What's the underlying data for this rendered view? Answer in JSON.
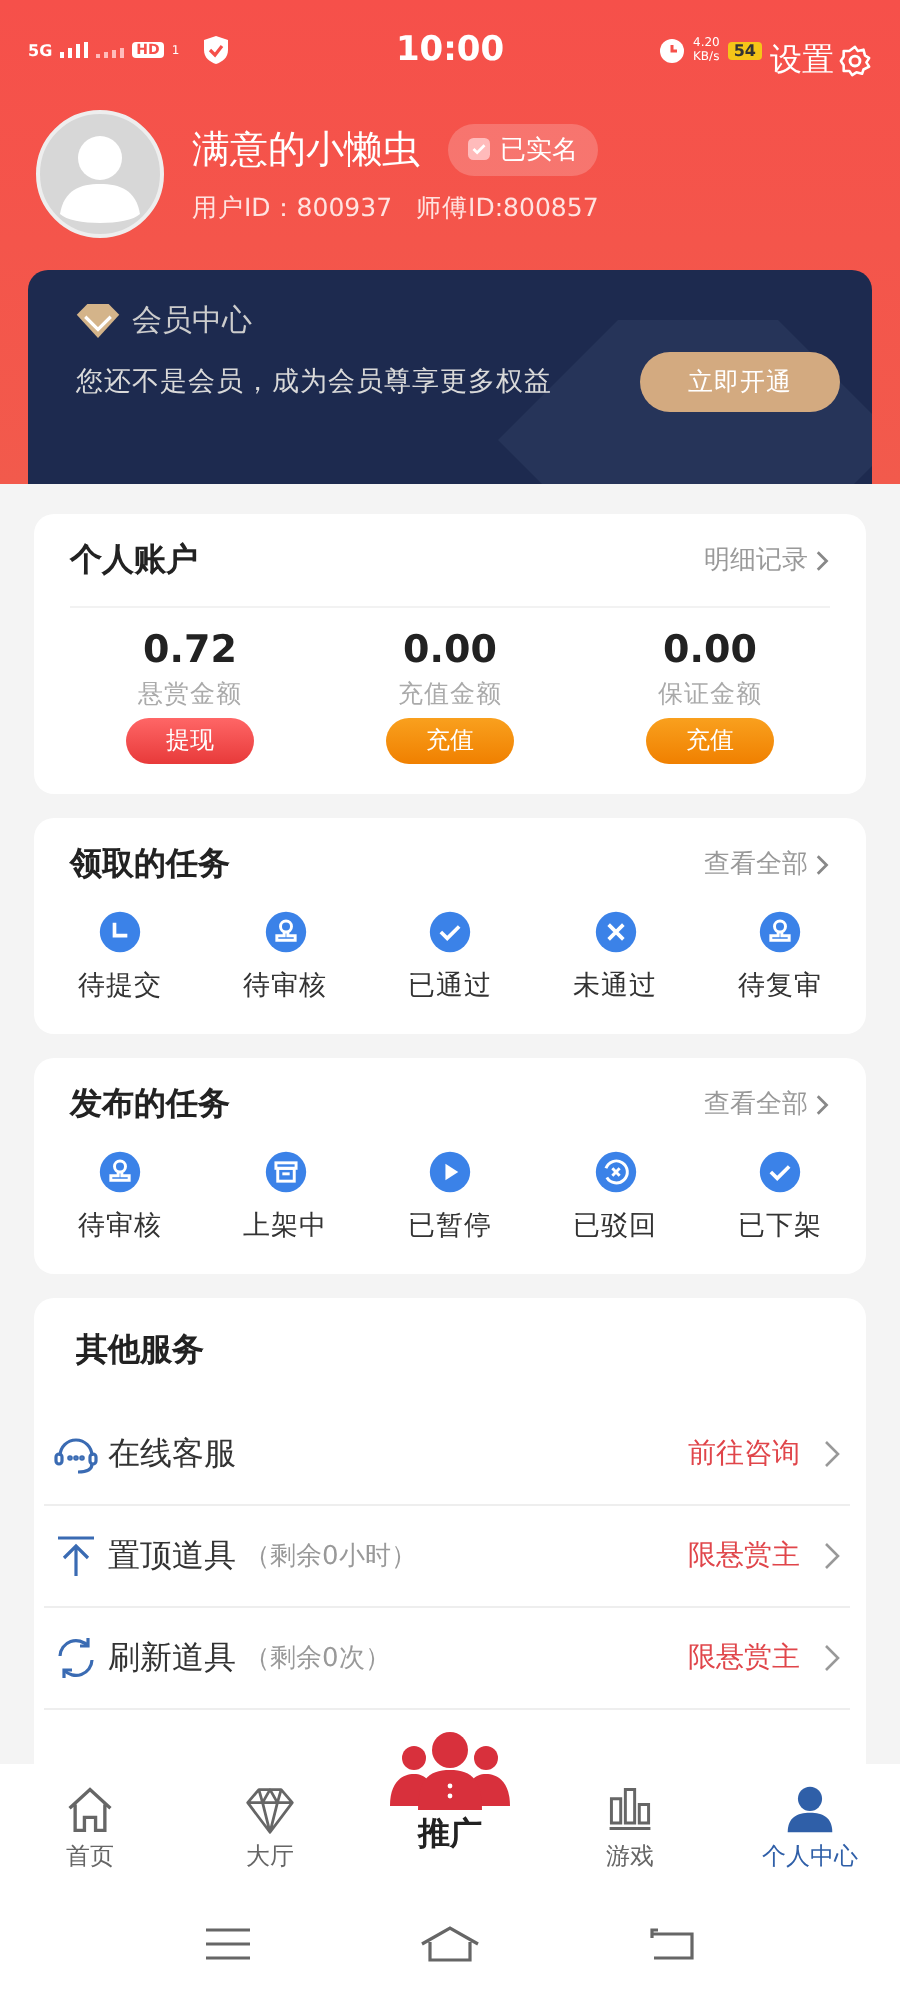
{
  "status_bar": {
    "network": "5G",
    "hd": "HD",
    "sim": "1",
    "time": "10:00",
    "speed": "4.20",
    "speed_unit": "KB/s",
    "battery": "54"
  },
  "header": {
    "settings": "设置",
    "name": "满意的小懒虫",
    "verified": "已实名",
    "user_id": "用户ID：800937",
    "master_id": "师傅ID:800857"
  },
  "vip": {
    "title": "会员中心",
    "text": "您还不是会员，成为会员尊享更多权益",
    "button": "立即开通"
  },
  "account": {
    "title": "个人账户",
    "link": "明细记录",
    "items": [
      {
        "amount": "0.72",
        "label": "悬赏金额",
        "button": "提现",
        "kind": "withdraw"
      },
      {
        "amount": "0.00",
        "label": "充值金额",
        "button": "充值",
        "kind": "recharge"
      },
      {
        "amount": "0.00",
        "label": "保证金额",
        "button": "充值",
        "kind": "recharge"
      }
    ]
  },
  "received_tasks": {
    "title": "领取的任务",
    "link": "查看全部",
    "items": [
      {
        "label": "待提交",
        "kind": "clock"
      },
      {
        "label": "待审核",
        "kind": "stamp"
      },
      {
        "label": "已通过",
        "kind": "check"
      },
      {
        "label": "未通过",
        "kind": "cross"
      },
      {
        "label": "待复审",
        "kind": "stamp"
      }
    ]
  },
  "published_tasks": {
    "title": "发布的任务",
    "link": "查看全部",
    "items": [
      {
        "label": "待审核",
        "kind": "stamp"
      },
      {
        "label": "上架中",
        "kind": "box"
      },
      {
        "label": "已暂停",
        "kind": "play"
      },
      {
        "label": "已驳回",
        "kind": "reject"
      },
      {
        "label": "已下架",
        "kind": "check"
      }
    ]
  },
  "other_services": {
    "title": "其他服务",
    "items": [
      {
        "label": "在线客服",
        "action": "前往咨询",
        "kind": "headset"
      },
      {
        "label": "置顶道具",
        "note": "（剩余0小时）",
        "action": "限悬赏主",
        "kind": "top"
      },
      {
        "label": "刷新道具",
        "note": "（剩余0次）",
        "action": "限悬赏主",
        "kind": "refresh"
      }
    ]
  },
  "tab_bar": [
    {
      "label": "首页",
      "kind": "home",
      "selected": false
    },
    {
      "label": "大厅",
      "kind": "diamond",
      "selected": false
    },
    {
      "label": "推广",
      "kind": "promote",
      "selected": false
    },
    {
      "label": "游戏",
      "kind": "chart",
      "selected": false
    },
    {
      "label": "个人中心",
      "kind": "person",
      "selected": true
    }
  ]
}
